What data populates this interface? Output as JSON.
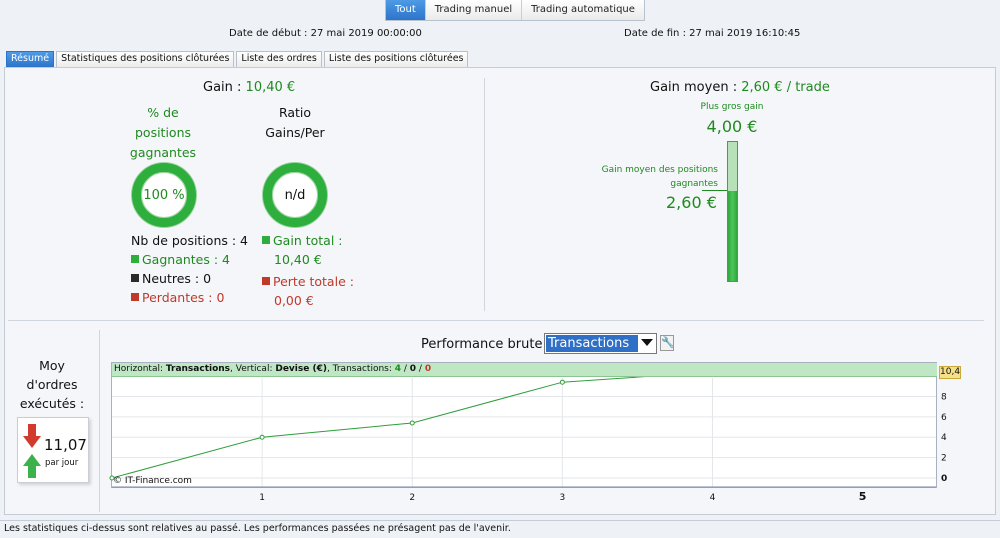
{
  "mode_tabs": [
    "Tout",
    "Trading manuel",
    "Trading automatique"
  ],
  "dates": {
    "start": "Date de début : 27 mai 2019 00:00:00",
    "end": "Date de fin : 27 mai 2019 16:10:45"
  },
  "sub_tabs": [
    "Résumé",
    "Statistiques des positions clôturées",
    "Liste des ordres",
    "Liste des positions clôturées"
  ],
  "summary": {
    "gain_label": "Gain : ",
    "gain_value": "10,40 €",
    "pct_label_1": "% de",
    "pct_label_2": "positions",
    "pct_label_3": "gagnantes",
    "pct_value": "100 %",
    "ratio_label_1": "Ratio",
    "ratio_label_2": "Gains/Per",
    "ratio_value": "n/d",
    "nb_positions": "Nb de positions : 4",
    "gagnantes": "Gagnantes : 4",
    "neutres": "Neutres : 0",
    "perdantes": "Perdantes : 0",
    "gain_total_label": "Gain total :",
    "gain_total_value": "10,40 €",
    "perte_totale_label": "Perte totale :",
    "perte_totale_value": "0,00 €"
  },
  "avg": {
    "label": "Gain moyen : ",
    "value": "2,60 € / trade",
    "biggest_label": "Plus gros gain",
    "biggest_value": "4,00 €",
    "avg_label_1": "Gain moyen des positions",
    "avg_label_2": "gagnantes",
    "avg_value": "2,60 €",
    "bar_fraction": 0.65
  },
  "orders": {
    "label_1": "Moy",
    "label_2": "d'ordres",
    "label_3": "exécutés :",
    "value": "11,07",
    "unit": "par jour"
  },
  "perf": {
    "title": "Performance brute",
    "selected": "Transactions",
    "legend_h_label": "Horizontal: ",
    "legend_h_value": "Transactions",
    "legend_v_label": ", Vertical: ",
    "legend_v_value": "Devise (€)",
    "legend_t_label": ", Transactions: ",
    "legend_t_win": "4",
    "legend_sep": " / ",
    "legend_t_neutral": "0",
    "legend_t_loss": "0",
    "watermark": "© IT-Finance.com",
    "highlight_value": "10,4"
  },
  "chart_data": {
    "type": "line",
    "x": [
      0,
      1,
      2,
      3,
      4
    ],
    "y": [
      0,
      4.0,
      5.4,
      9.4,
      10.4
    ],
    "xlim": [
      0,
      5
    ],
    "ylim": [
      0,
      10.4
    ],
    "x_ticks": [
      "1",
      "2",
      "3",
      "4",
      "5"
    ],
    "y_ticks": [
      "0",
      "2",
      "4",
      "6",
      "8"
    ],
    "grid": true,
    "line_color": "#2e9e3a"
  },
  "footer": "Les statistiques ci-dessus sont relatives au passé. Les performances passées ne présagent pas de l'avenir."
}
